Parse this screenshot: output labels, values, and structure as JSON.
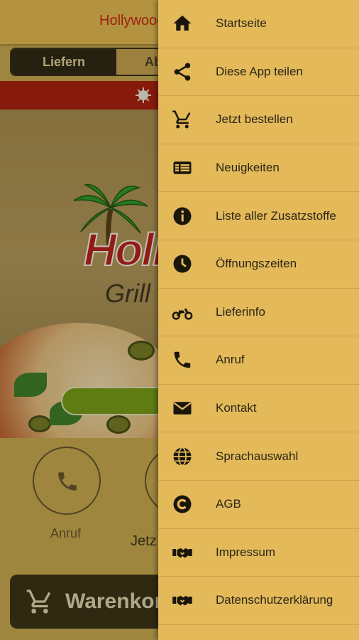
{
  "app": {
    "title": "Hollywood",
    "segment": {
      "active": "Liefern",
      "inactive": "Abholung"
    },
    "logo": {
      "brand": "Holly",
      "sub": "Grill"
    },
    "actions": [
      {
        "label": "Anruf",
        "icon": "phone-icon"
      },
      {
        "label": "Jetz",
        "icon": "cart-icon"
      }
    ],
    "cart_button": "Warenkorb"
  },
  "drawer": {
    "items": [
      {
        "label": "Startseite",
        "icon": "home-icon"
      },
      {
        "label": "Diese App teilen",
        "icon": "share-icon"
      },
      {
        "label": "Jetzt bestellen",
        "icon": "cart-icon"
      },
      {
        "label": "Neuigkeiten",
        "icon": "news-icon"
      },
      {
        "label": "Liste aller Zusatzstoffe",
        "icon": "info-icon"
      },
      {
        "label": "Öffnungszeiten",
        "icon": "clock-icon"
      },
      {
        "label": "Lieferinfo",
        "icon": "motorcycle-icon"
      },
      {
        "label": "Anruf",
        "icon": "phone-icon"
      },
      {
        "label": "Kontakt",
        "icon": "mail-icon"
      },
      {
        "label": "Sprachauswahl",
        "icon": "globe-icon"
      },
      {
        "label": "AGB",
        "icon": "copyright-icon"
      },
      {
        "label": "Impressum",
        "icon": "handshake-icon"
      },
      {
        "label": "Datenschutzerklärung",
        "icon": "handshake-icon"
      }
    ]
  },
  "colors": {
    "accent": "#e3b95a",
    "title_red": "#c81c14",
    "banner_red": "#a8130c",
    "dark": "#1c1a14"
  }
}
